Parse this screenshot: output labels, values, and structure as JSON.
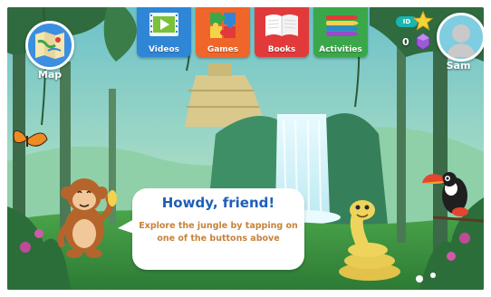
{
  "nav": {
    "videos_label": "Videos",
    "games_label": "Games",
    "books_label": "Books",
    "activities_label": "Activities"
  },
  "map": {
    "label": "Map",
    "icon": "folded-map-icon"
  },
  "profile": {
    "name": "Sam",
    "id_badge": "ID",
    "gem_count": "0",
    "icons": [
      "star-icon",
      "gem-icon",
      "avatar-silhouette-icon"
    ]
  },
  "dialog": {
    "title": "Howdy, friend!",
    "message": "Explore the jungle by tapping on one of the buttons above"
  },
  "colors": {
    "videos": "#2f86d6",
    "games": "#f0662a",
    "books": "#e23a3a",
    "activities": "#3aa84a",
    "title_blue": "#1e5fb8",
    "message_orange": "#c8823a"
  }
}
